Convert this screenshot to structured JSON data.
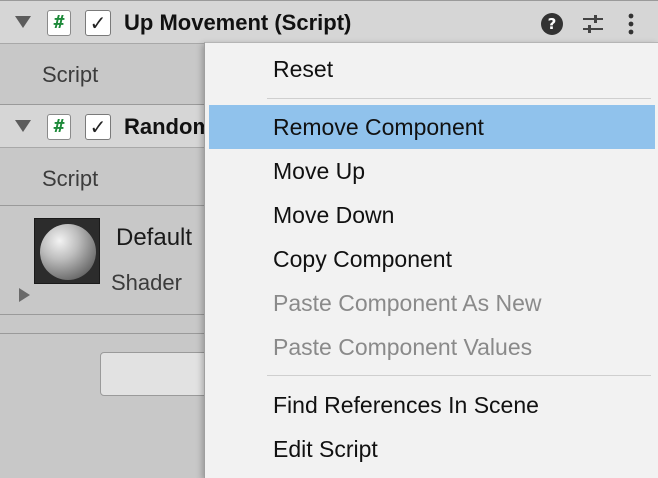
{
  "components": [
    {
      "title": "Up Movement (Script)",
      "enabled": true,
      "icon": "csharp-script-icon",
      "property_label": "Script"
    },
    {
      "title": "Random",
      "enabled": true,
      "icon": "csharp-script-icon",
      "property_label": "Script"
    }
  ],
  "material": {
    "name": "Default",
    "shader_label": "Shader"
  },
  "header_icons": {
    "help": "?",
    "presets": "sliders-icon",
    "menu": "kebab-menu-icon"
  },
  "context_menu": {
    "items": [
      {
        "label": "Reset",
        "enabled": true
      },
      {
        "label": "Remove Component",
        "enabled": true,
        "highlighted": true
      },
      {
        "label": "Move Up",
        "enabled": true
      },
      {
        "label": "Move Down",
        "enabled": true
      },
      {
        "label": "Copy Component",
        "enabled": true
      },
      {
        "label": "Paste Component As New",
        "enabled": false
      },
      {
        "label": "Paste Component Values",
        "enabled": false
      },
      {
        "label": "Find References In Scene",
        "enabled": true
      },
      {
        "label": "Edit Script",
        "enabled": true
      }
    ]
  },
  "colors": {
    "highlight": "#90c2ec",
    "script_hash": "#1e8a3a",
    "disabled_text": "#8a8a8a"
  }
}
